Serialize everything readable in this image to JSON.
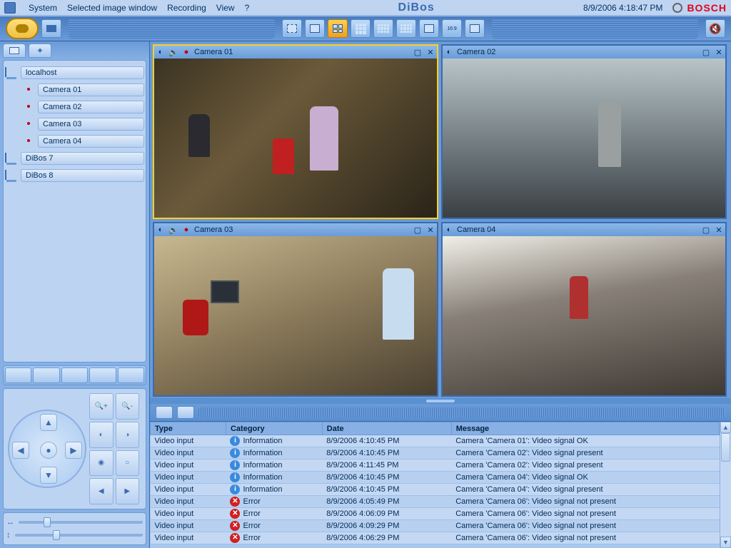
{
  "menu": {
    "items": [
      "System",
      "Selected image window",
      "Recording",
      "View",
      "?"
    ],
    "title": "DiBos",
    "datetime": "8/9/2006 4:18:47 PM",
    "brand": "BOSCH"
  },
  "tree": {
    "nodes": [
      {
        "type": "host",
        "label": "localhost",
        "indent": 0
      },
      {
        "type": "camera",
        "label": "Camera 01",
        "indent": 1
      },
      {
        "type": "camera",
        "label": "Camera 02",
        "indent": 1
      },
      {
        "type": "camera",
        "label": "Camera 03",
        "indent": 1
      },
      {
        "type": "camera",
        "label": "Camera 04",
        "indent": 1
      },
      {
        "type": "host",
        "label": "DiBos 7",
        "indent": 0
      },
      {
        "type": "host",
        "label": "DiBos 8",
        "indent": 0
      }
    ]
  },
  "cameras": [
    {
      "title": "Camera 01",
      "selected": true
    },
    {
      "title": "Camera 02",
      "selected": false
    },
    {
      "title": "Camera 03",
      "selected": false
    },
    {
      "title": "Camera 04",
      "selected": false
    }
  ],
  "log": {
    "columns": [
      "Type",
      "Category",
      "Date",
      "Message"
    ],
    "rows": [
      {
        "type": "Video input",
        "cat": "Information",
        "date": "8/9/2006 4:10:45 PM",
        "msg": "Camera 'Camera 01': Video signal OK"
      },
      {
        "type": "Video input",
        "cat": "Information",
        "date": "8/9/2006 4:10:45 PM",
        "msg": "Camera 'Camera 02': Video signal present"
      },
      {
        "type": "Video input",
        "cat": "Information",
        "date": "8/9/2006 4:11:45 PM",
        "msg": "Camera 'Camera 02': Video signal present"
      },
      {
        "type": "Video input",
        "cat": "Information",
        "date": "8/9/2006 4:10:45 PM",
        "msg": "Camera 'Camera 04': Video signal OK"
      },
      {
        "type": "Video input",
        "cat": "Information",
        "date": "8/9/2006 4:10:45 PM",
        "msg": "Camera 'Camera 04': Video signal present"
      },
      {
        "type": "Video input",
        "cat": "Error",
        "date": "8/9/2006 4:05:49 PM",
        "msg": "Camera 'Camera 06': Video signal not present"
      },
      {
        "type": "Video input",
        "cat": "Error",
        "date": "8/9/2006 4:06:09 PM",
        "msg": "Camera 'Camera 06': Video signal not present"
      },
      {
        "type": "Video input",
        "cat": "Error",
        "date": "8/9/2006 4:09:29 PM",
        "msg": "Camera 'Camera 06': Video signal not present"
      },
      {
        "type": "Video input",
        "cat": "Error",
        "date": "8/9/2006 4:06:29 PM",
        "msg": "Camera 'Camera 06': Video signal not present"
      }
    ]
  }
}
